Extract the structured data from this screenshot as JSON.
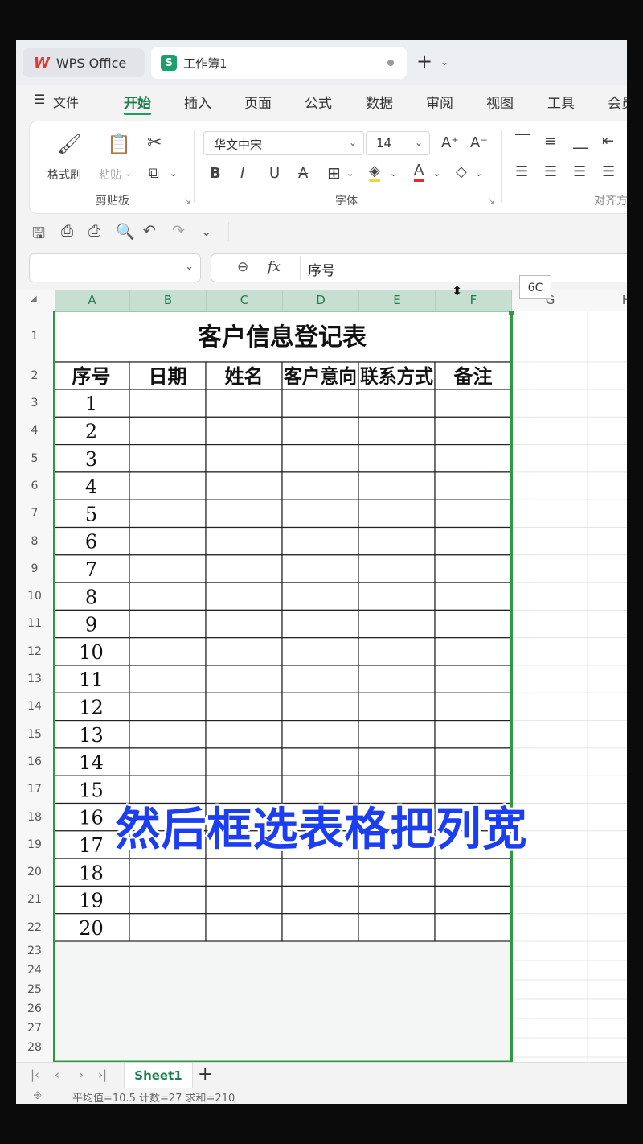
{
  "titlebar": {
    "app_tab": "WPS Office",
    "doc_tab": "工作簿1",
    "new_tab": "+",
    "new_tab_dropdown": "⌄"
  },
  "menu": {
    "items": [
      {
        "label": "文件"
      },
      {
        "label": "开始"
      },
      {
        "label": "插入"
      },
      {
        "label": "页面"
      },
      {
        "label": "公式"
      },
      {
        "label": "数据"
      },
      {
        "label": "审阅"
      },
      {
        "label": "视图"
      },
      {
        "label": "工具"
      },
      {
        "label": "会员"
      }
    ],
    "active": "开始"
  },
  "ribbon": {
    "format_painter": "格式刷",
    "paste": "粘贴",
    "clipboard_group": "剪贴板",
    "font_name": "华文中宋",
    "font_size": "14",
    "font_group": "字体",
    "bold": "B",
    "italic": "I",
    "underline": "U",
    "strike": "A",
    "align_group": "对齐方"
  },
  "formula_bar": {
    "cell_ref": "",
    "fx": "fx",
    "content": "序号"
  },
  "tooltip": "6C",
  "grid": {
    "columns": [
      "A",
      "B",
      "C",
      "D",
      "E",
      "F",
      "G",
      "H"
    ],
    "row_numbers": [
      "1",
      "2",
      "3",
      "4",
      "5",
      "6",
      "7",
      "8",
      "9",
      "10",
      "11",
      "12",
      "13",
      "14",
      "15",
      "16",
      "17",
      "18",
      "19",
      "20",
      "21",
      "22",
      "23",
      "24",
      "25",
      "26",
      "27",
      "28"
    ],
    "table_title": "客户信息登记表",
    "headers": [
      "序号",
      "日期",
      "姓名",
      "客户意向",
      "联系方式",
      "备注"
    ],
    "serials": [
      "1",
      "2",
      "3",
      "4",
      "5",
      "6",
      "7",
      "8",
      "9",
      "10",
      "11",
      "12",
      "13",
      "14",
      "15",
      "16",
      "17",
      "18",
      "19",
      "20"
    ]
  },
  "sheet": {
    "tab": "Sheet1",
    "add": "+"
  },
  "status": {
    "text": "平均值=10.5  计数=27  求和=210"
  },
  "caption": "然后框选表格把列宽",
  "colors": {
    "accent": "#1e7e4c",
    "selection_border": "#2d9a3f",
    "caption": "#1b3ff0"
  }
}
